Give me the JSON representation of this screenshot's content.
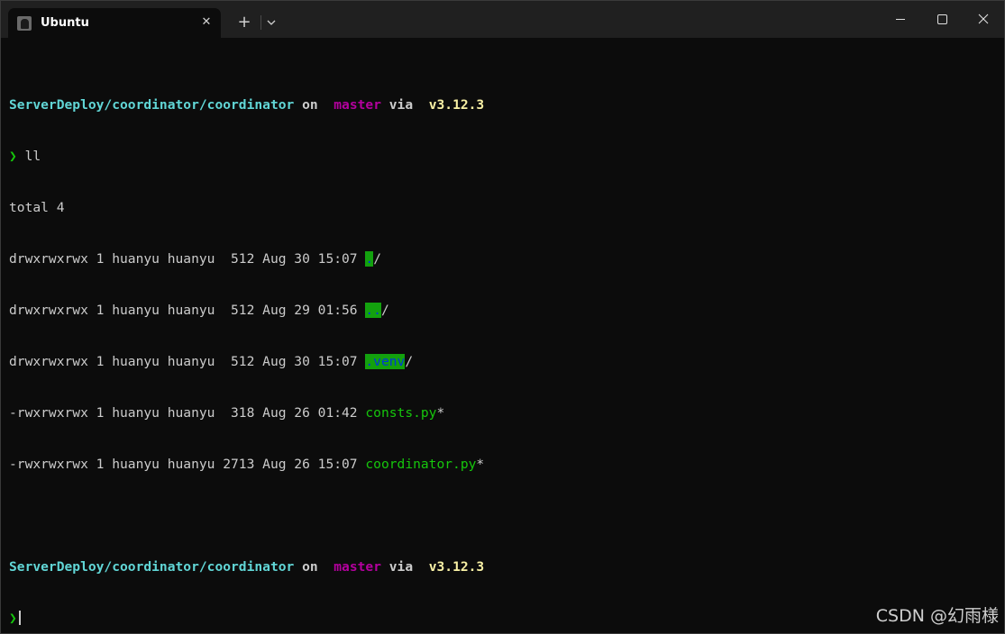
{
  "window": {
    "tab_title": "Ubuntu",
    "close_tab_symbol": "✕",
    "new_tab_symbol": "+"
  },
  "prompt": {
    "path": "ServerDeploy/coordinator/coordinator",
    "on": " on ",
    "branch_icon": "",
    "branch": "master",
    "via": " via ",
    "python_icon": "",
    "python_version": "v3.12.3",
    "symbol": "❯"
  },
  "commands": {
    "first": " ll"
  },
  "listing": {
    "total": "total 4",
    "rows": [
      {
        "meta": "drwxrwxrwx 1 huanyu huanyu  512 Aug 30 15:07 ",
        "name": ".",
        "suffix": "/"
      },
      {
        "meta": "drwxrwxrwx 1 huanyu huanyu  512 Aug 29 01:56 ",
        "name": "..",
        "suffix": "/"
      },
      {
        "meta": "drwxrwxrwx 1 huanyu huanyu  512 Aug 30 15:07 ",
        "name": ".venv",
        "suffix": "/"
      },
      {
        "meta": "-rwxrwxrwx 1 huanyu huanyu  318 Aug 26 01:42 ",
        "name": "consts.py",
        "suffix": "*"
      },
      {
        "meta": "-rwxrwxrwx 1 huanyu huanyu 2713 Aug 26 15:07 ",
        "name": "coordinator.py",
        "suffix": "*"
      }
    ]
  },
  "watermark": "CSDN @幻雨様",
  "colors": {
    "background": "#0c0c0c",
    "titlebar": "#202020",
    "path": "#61d6d6",
    "branch": "#b4009e",
    "version": "#f9f1a5",
    "green": "#16c60c",
    "dir_highlight": "#13a10e",
    "dir_text": "#0037da"
  },
  "icons": {
    "tab": "linux-penguin-icon",
    "close": "close-icon",
    "new_tab": "plus-icon",
    "dropdown": "chevron-down-icon",
    "minimize": "minimize-icon",
    "maximize": "maximize-icon",
    "window_close": "window-close-icon",
    "branch": "git-branch-icon",
    "python": "python-icon"
  }
}
